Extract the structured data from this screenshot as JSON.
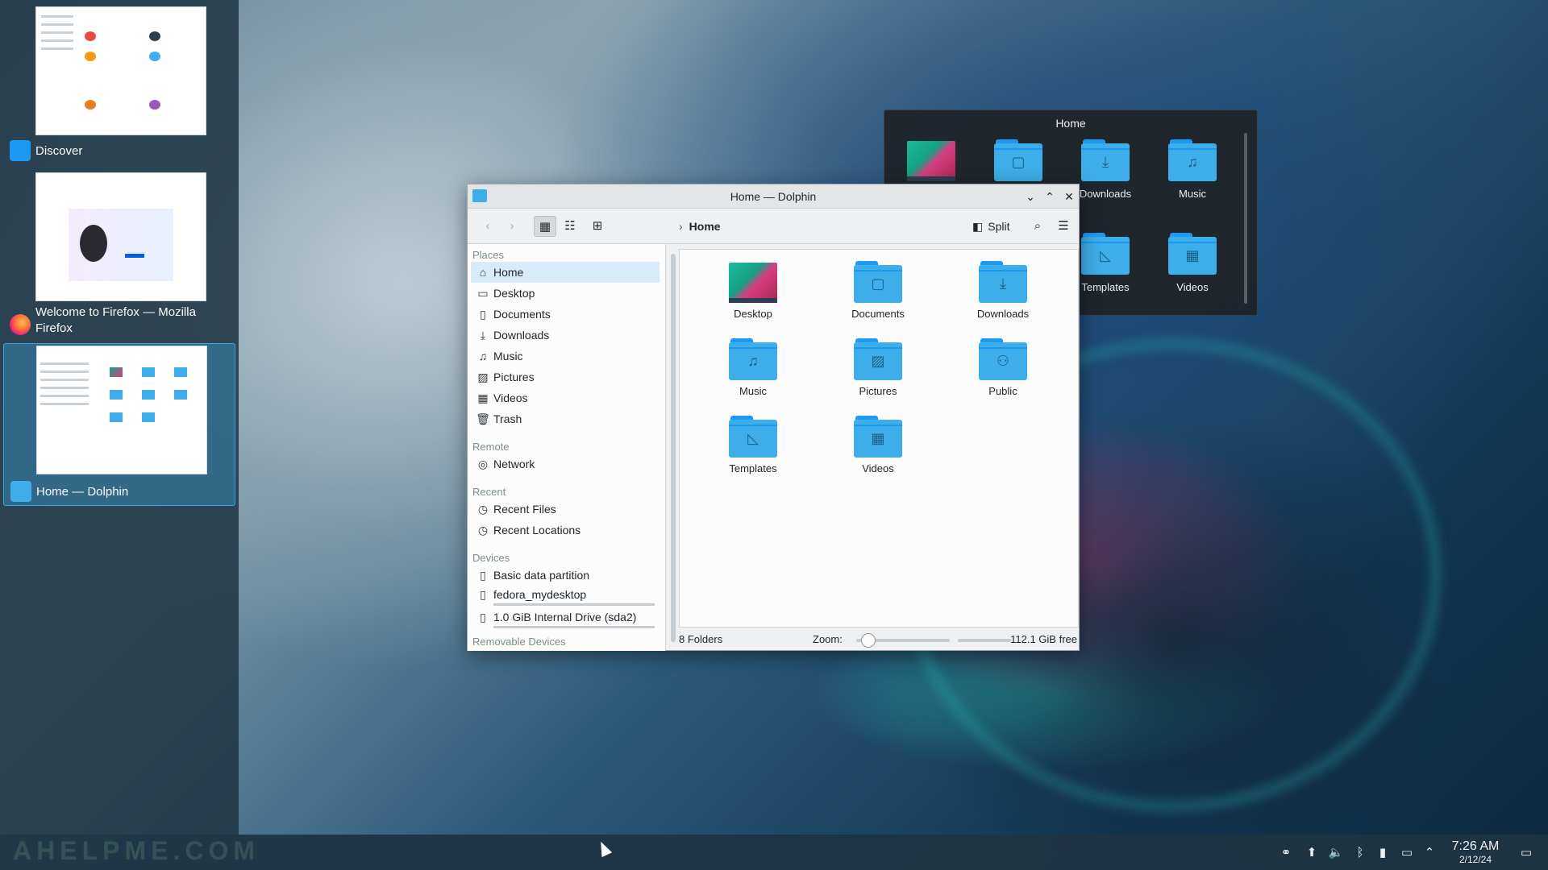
{
  "switcher": {
    "items": [
      {
        "title": "Discover",
        "icon": "discover-icon"
      },
      {
        "title": "Welcome to Firefox — Mozilla Firefox",
        "icon": "firefox-icon"
      },
      {
        "title": "Home — Dolphin",
        "icon": "dolphin-icon",
        "active": true
      }
    ]
  },
  "popup": {
    "title": "Home",
    "items": [
      "",
      "",
      "Downloads",
      "Music",
      "Templates",
      "Videos"
    ]
  },
  "window": {
    "title": "Home — Dolphin",
    "toolbar": {
      "breadcrumb": "Home",
      "split_label": "Split"
    },
    "places": {
      "sections": {
        "places": "Places",
        "remote": "Remote",
        "recent": "Recent",
        "devices": "Devices",
        "removable": "Removable Devices"
      },
      "places_items": [
        "Home",
        "Desktop",
        "Documents",
        "Downloads",
        "Music",
        "Pictures",
        "Videos",
        "Trash"
      ],
      "remote_items": [
        "Network"
      ],
      "recent_items": [
        "Recent Files",
        "Recent Locations"
      ],
      "device_items": [
        "Basic data partition",
        "fedora_mydesktop",
        "1.0 GiB Internal Drive (sda2)"
      ]
    },
    "content": {
      "items": [
        "Desktop",
        "Documents",
        "Downloads",
        "Music",
        "Pictures",
        "Public",
        "Templates",
        "Videos"
      ]
    },
    "status": {
      "summary": "8 Folders",
      "zoom_label": "Zoom:",
      "free_space": "112.1 GiB free"
    }
  },
  "panel": {
    "time": "7:26 AM",
    "date": "2/12/24"
  },
  "watermark": "AHELPME.COM",
  "colors": {
    "accent": "#3daee9",
    "folder_dark": "#1d99f3",
    "panel_bg": "#1e3444"
  }
}
